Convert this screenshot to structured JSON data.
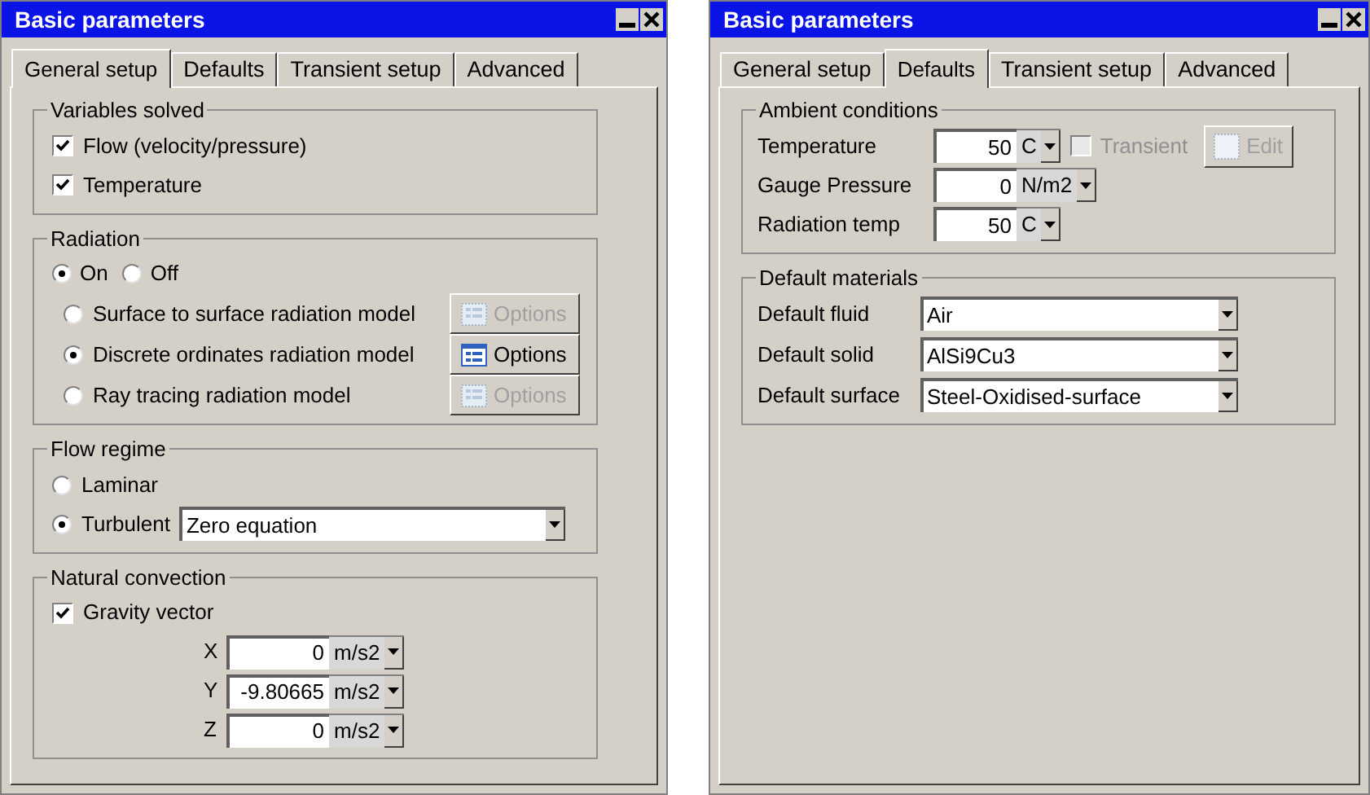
{
  "windows": [
    {
      "title": "Basic parameters",
      "tabs": [
        {
          "label": "General setup",
          "selected": true
        },
        {
          "label": "Defaults",
          "selected": false
        },
        {
          "label": "Transient setup",
          "selected": false
        },
        {
          "label": "Advanced",
          "selected": false
        }
      ],
      "sections": [
        {
          "title": "Variables solved",
          "rows": [
            {
              "kind": "checkbox",
              "label": "Flow (velocity/pressure)",
              "checked": true
            },
            {
              "kind": "checkbox",
              "label": "Temperature",
              "checked": true
            }
          ]
        },
        {
          "title": "Radiation",
          "rows": [
            {
              "kind": "radio_group",
              "options": [
                {
                  "label": "On",
                  "selected": true
                },
                {
                  "label": "Off",
                  "selected": false
                }
              ]
            },
            {
              "kind": "radio_option",
              "label": "Surface to surface radiation model",
              "selected": false,
              "button": {
                "label": "Options",
                "disabled": true
              }
            },
            {
              "kind": "radio_option",
              "label": "Discrete ordinates radiation model",
              "selected": true,
              "button": {
                "label": "Options",
                "disabled": false
              }
            },
            {
              "kind": "radio_option",
              "label": "Ray tracing radiation model",
              "selected": false,
              "button": {
                "label": "Options",
                "disabled": true
              }
            }
          ]
        },
        {
          "title": "Flow regime",
          "rows": [
            {
              "kind": "radio",
              "label": "Laminar",
              "selected": false
            },
            {
              "kind": "radio_dropdown",
              "label": "Turbulent",
              "selected": true,
              "value": "Zero equation"
            }
          ]
        },
        {
          "title": "Natural convection",
          "rows": [
            {
              "kind": "checkbox",
              "label": "Gravity vector",
              "checked": true
            },
            {
              "kind": "vector",
              "axis": "X",
              "value": "0",
              "unit": "m/s2"
            },
            {
              "kind": "vector",
              "axis": "Y",
              "value": "-9.80665",
              "unit": "m/s2"
            },
            {
              "kind": "vector",
              "axis": "Z",
              "value": "0",
              "unit": "m/s2"
            }
          ]
        }
      ]
    },
    {
      "title": "Basic parameters",
      "tabs": [
        {
          "label": "General setup",
          "selected": false
        },
        {
          "label": "Defaults",
          "selected": true
        },
        {
          "label": "Transient setup",
          "selected": false
        },
        {
          "label": "Advanced",
          "selected": false
        }
      ],
      "sections": [
        {
          "title": "Ambient conditions",
          "rows": [
            {
              "kind": "quantity",
              "label": "Temperature",
              "value": "50",
              "unit": "C",
              "checkbox": {
                "label": "Transient",
                "checked": false,
                "disabled": true
              },
              "button": {
                "label": "Edit",
                "disabled": true
              }
            },
            {
              "kind": "quantity",
              "label": "Gauge Pressure",
              "value": "0",
              "unit": "N/m2"
            },
            {
              "kind": "quantity",
              "label": "Radiation temp",
              "value": "50",
              "unit": "C"
            }
          ]
        },
        {
          "title": "Default materials",
          "rows": [
            {
              "kind": "dropdown",
              "label": "Default fluid",
              "value": "Air"
            },
            {
              "kind": "dropdown",
              "label": "Default solid",
              "value": "AlSi9Cu3"
            },
            {
              "kind": "dropdown",
              "label": "Default surface",
              "value": "Steel-Oxidised-surface"
            }
          ]
        }
      ]
    }
  ]
}
